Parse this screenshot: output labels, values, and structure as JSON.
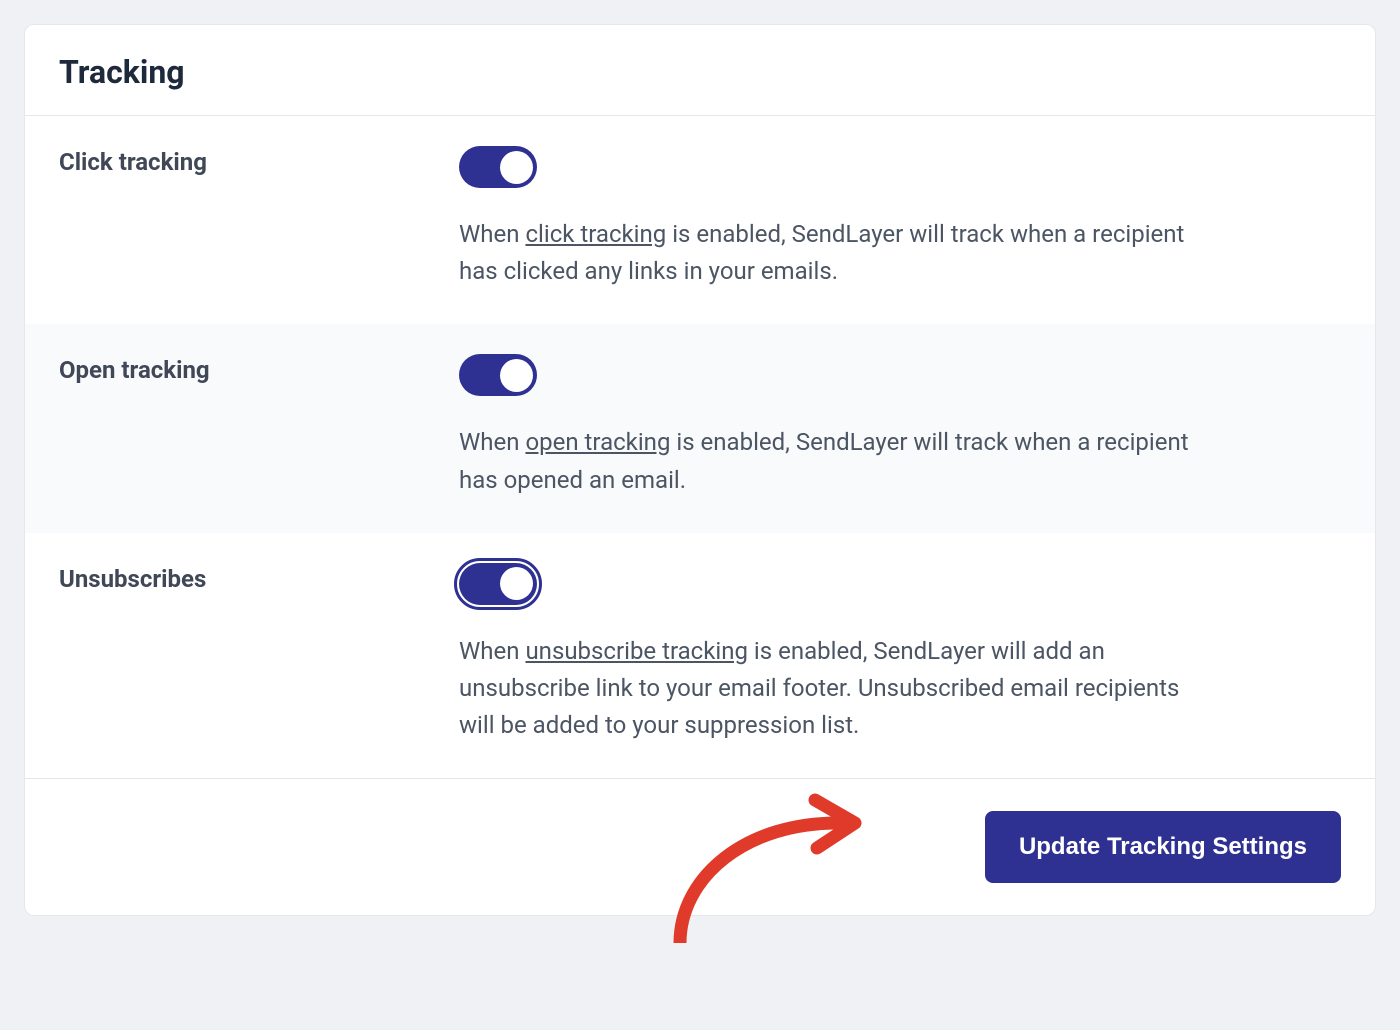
{
  "card": {
    "title": "Tracking"
  },
  "settings": {
    "click_tracking": {
      "label": "Click tracking",
      "desc_before": "When ",
      "desc_link": "click tracking",
      "desc_after": " is enabled, SendLayer will track when a recipient has clicked any links in your emails."
    },
    "open_tracking": {
      "label": "Open tracking",
      "desc_before": "When ",
      "desc_link": "open tracking",
      "desc_after": " is enabled, SendLayer will track when a recipient has opened an email."
    },
    "unsubscribes": {
      "label": "Unsubscribes",
      "desc_before": "When ",
      "desc_link": "unsubscribe tracking",
      "desc_after": " is enabled, SendLayer will add an unsubscribe link to your email footer. Unsubscribed email recipients will be added to your suppression list."
    }
  },
  "footer": {
    "button_label": "Update Tracking Settings"
  }
}
